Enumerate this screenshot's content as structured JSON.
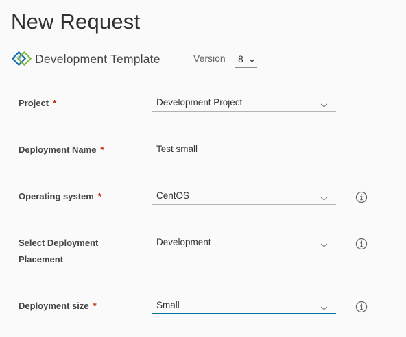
{
  "page": {
    "title": "New Request"
  },
  "template": {
    "name": "Development Template",
    "version_label": "Version",
    "version_value": "8"
  },
  "fields": [
    {
      "label": "Project",
      "required": "*",
      "value": "Development Project",
      "type": "select"
    },
    {
      "label": "Deployment Name",
      "required": "*",
      "value": "Test small",
      "type": "text"
    },
    {
      "label": "Operating system",
      "required": "*",
      "value": "CentOS",
      "type": "select"
    },
    {
      "label_line1": "Select Deployment",
      "label_line2": "Placement",
      "value": "Development",
      "type": "select"
    },
    {
      "label": "Deployment size",
      "required": "*",
      "value": "Small",
      "type": "select",
      "focused": true
    }
  ],
  "colors": {
    "required": "#c92100",
    "focus": "#0072a3",
    "logo_blue": "#1f6cae",
    "logo_green": "#7cbc3b"
  },
  "icons": {
    "logo": "blueprint-logo-icon",
    "info": "info-circle-icon",
    "chevron": "chevron-down-icon"
  }
}
